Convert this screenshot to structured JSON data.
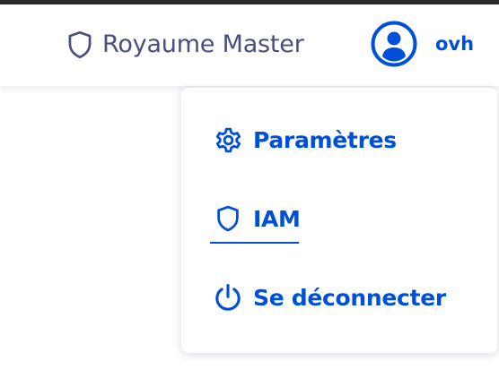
{
  "header": {
    "realm_label": "Royaume Master",
    "username": "ovh"
  },
  "menu": {
    "items": [
      {
        "label": "Paramètres",
        "icon": "gear-icon"
      },
      {
        "label": "IAM",
        "icon": "shield-icon",
        "active": true
      },
      {
        "label": "Se déconnecter",
        "icon": "power-icon"
      }
    ]
  },
  "colors": {
    "accent": "#0050d7",
    "realm_text": "#4a4e7a",
    "top_border": "#2a2a2a"
  }
}
